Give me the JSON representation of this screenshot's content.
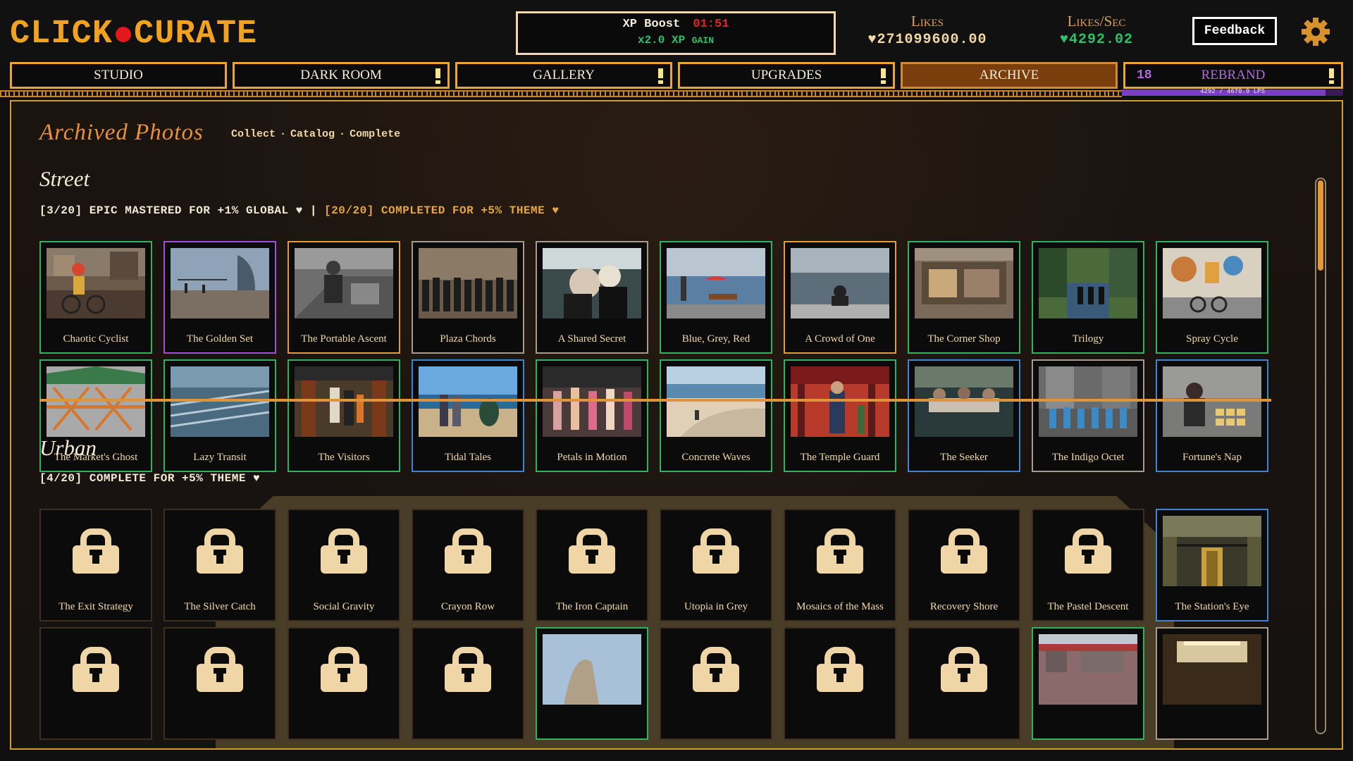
{
  "header": {
    "logo_left": "CLICK",
    "logo_right": "CURATE",
    "xp_boost_label": "XP Boost",
    "xp_boost_timer": "01:51",
    "xp_gain_value": "x2.0 XP",
    "xp_gain_suffix": "GAIN",
    "likes_label": "Likes",
    "likes_value": "♥271099600.00",
    "lps_label": "Likes/Sec",
    "lps_value": "♥4292.02",
    "feedback_label": "Feedback",
    "icons": {
      "settings": "gear-icon"
    }
  },
  "nav": {
    "tabs": [
      {
        "label": "STUDIO",
        "alert": false
      },
      {
        "label": "DARK ROOM",
        "alert": true
      },
      {
        "label": "GALLERY",
        "alert": true
      },
      {
        "label": "UPGRADES",
        "alert": true
      },
      {
        "label": "ARCHIVE",
        "alert": false,
        "active": true
      },
      {
        "label": "REBRAND",
        "alert": true,
        "count": "18"
      }
    ],
    "rebrand_progress_text": "4292 / 4670.9 LPS",
    "rebrand_progress_fraction": 0.919
  },
  "archive": {
    "title": "Archived Photos",
    "subnav": [
      "Collect",
      "Catalog",
      "Complete"
    ],
    "sections": [
      {
        "title": "Street",
        "stats_a": "[3/20] EPIC MASTERED FOR +1% GLOBAL ♥",
        "stats_sep": " | ",
        "stats_b": "[20/20] COMPLETED FOR +5% THEME ♥",
        "photos": [
          "Chaotic Cyclist",
          "The Golden Set",
          "The Portable Ascent",
          "Plaza Chords",
          "A Shared Secret",
          "Blue, Grey, Red",
          "A Crowd of One",
          "The Corner Shop",
          "Trilogy",
          "Spray Cycle",
          "The Market's Ghost",
          "Lazy Transit",
          "The Visitors",
          "Tidal Tales",
          "Petals in Motion",
          "Concrete Waves",
          "The Temple Guard",
          "The Seeker",
          "The Indigo Octet",
          "Fortune's Nap"
        ]
      },
      {
        "title": "Urban",
        "stats_a": "[4/20] COMPLETE FOR +5% THEME ♥",
        "photos": [
          "The Exit Strategy",
          "The Silver Catch",
          "Social Gravity",
          "Crayon Row",
          "The Iron Captain",
          "Utopia in Grey",
          "Mosaics of the Mass",
          "Recovery Shore",
          "The Pastel Descent",
          "The Station's Eye"
        ]
      }
    ]
  },
  "colors": {
    "accent_orange": "#f1a21f",
    "rarity_green": "#2fb35e",
    "rarity_purple": "#a84bd8",
    "rarity_orange": "#e79a3a",
    "rarity_blue": "#3f84d2",
    "boost_red": "#e2232b",
    "gain_green": "#2dc26a",
    "rebrand_purple": "#b26bdc"
  }
}
